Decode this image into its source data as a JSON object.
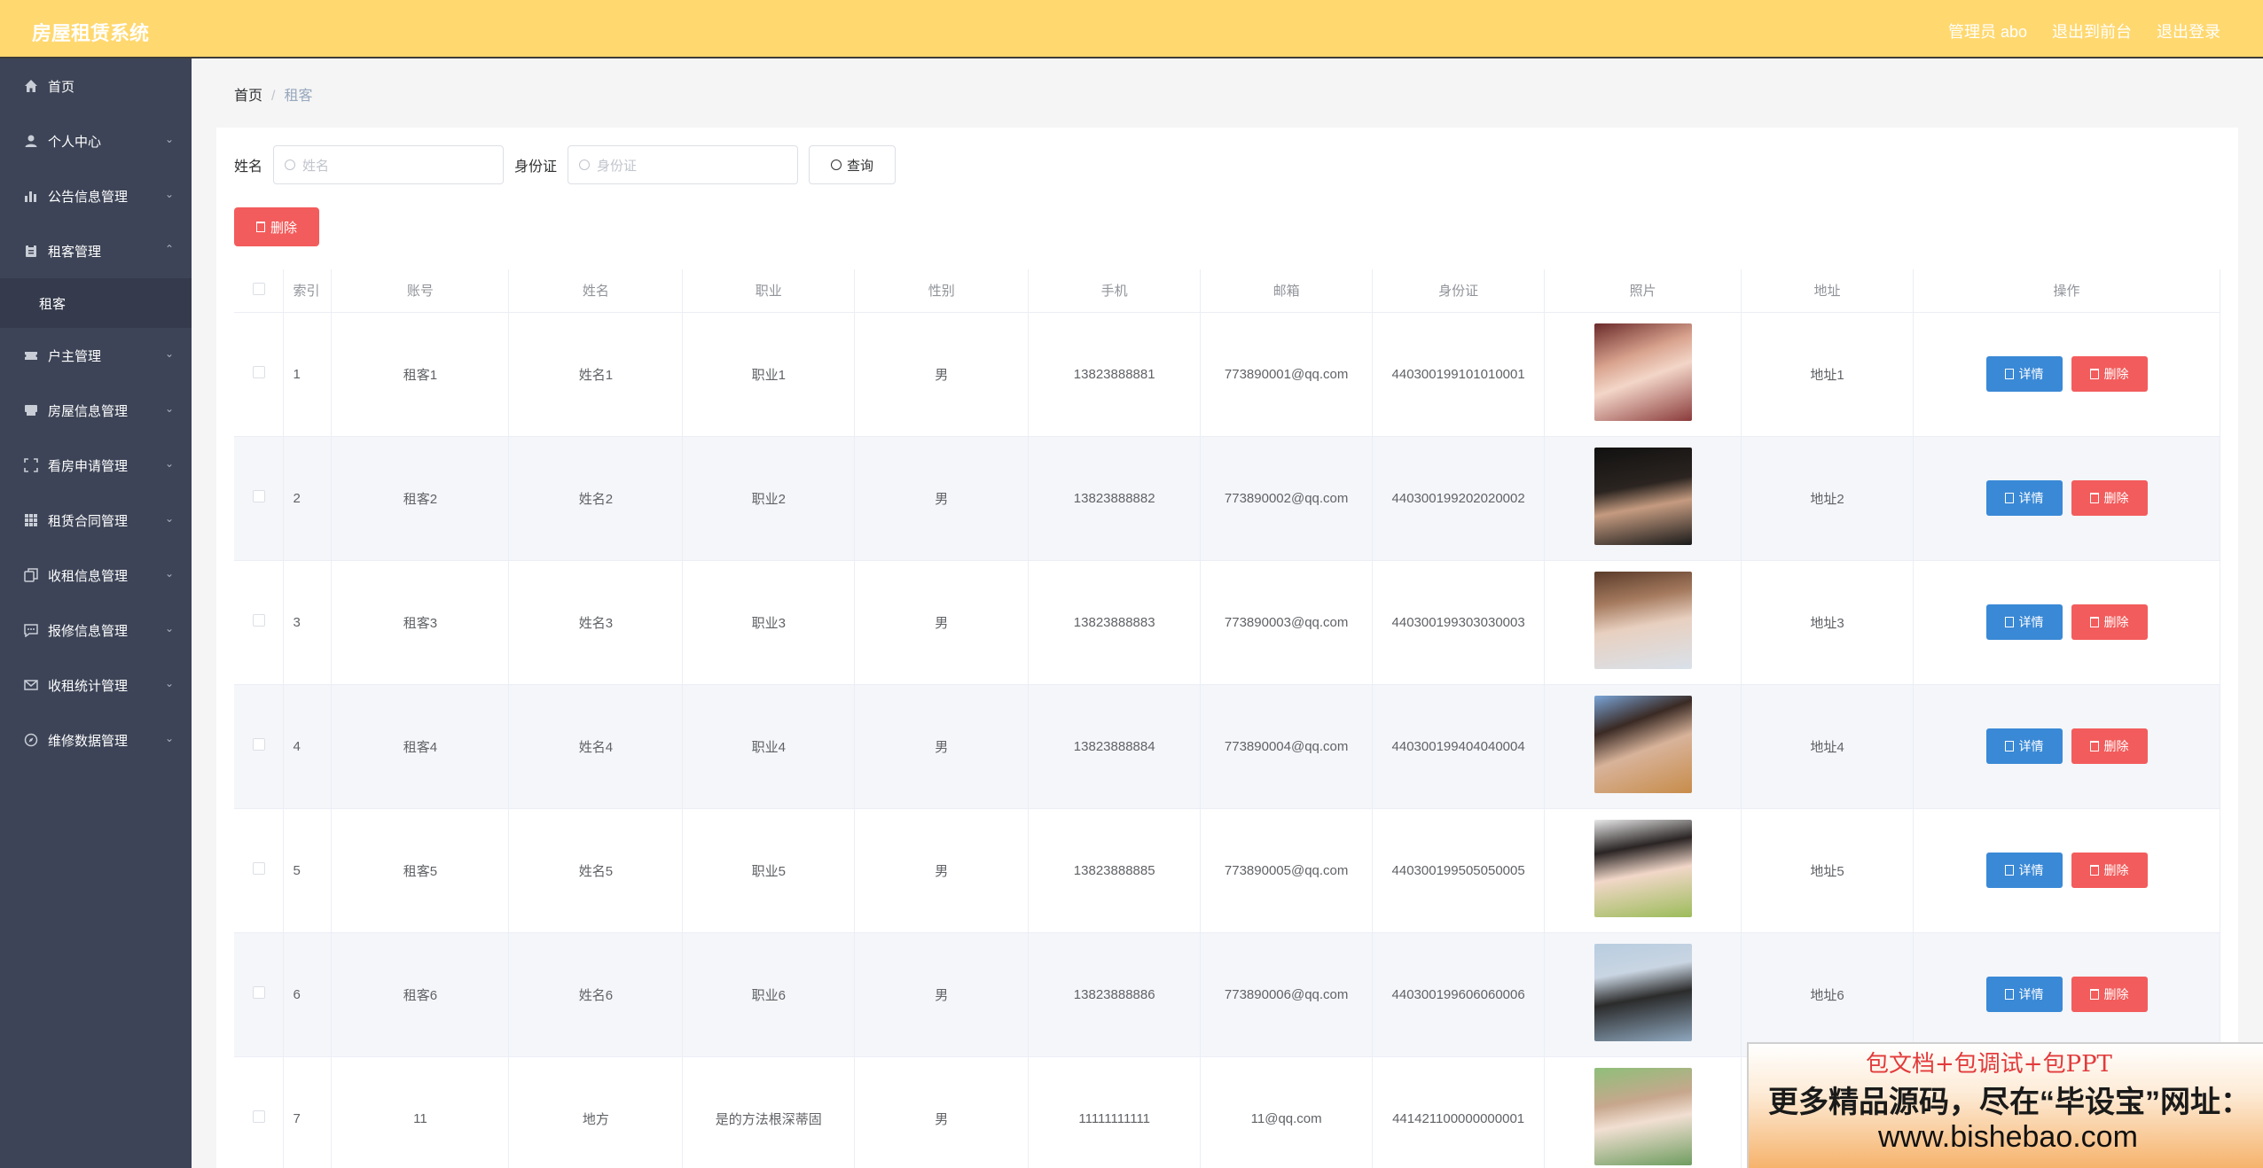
{
  "header": {
    "title": "房屋租赁系统",
    "admin": "管理员 abo",
    "back": "退出到前台",
    "logout": "退出登录"
  },
  "sidebar": {
    "items": [
      {
        "label": "首页",
        "icon": "home-icon"
      },
      {
        "label": "个人中心",
        "icon": "user-icon"
      },
      {
        "label": "公告信息管理",
        "icon": "chart-icon"
      },
      {
        "label": "租客管理",
        "icon": "clipboard-icon",
        "sub": "租客"
      },
      {
        "label": "户主管理",
        "icon": "ticket-icon"
      },
      {
        "label": "房屋信息管理",
        "icon": "archive-icon"
      },
      {
        "label": "看房申请管理",
        "icon": "fullscreen-icon"
      },
      {
        "label": "租赁合同管理",
        "icon": "grid-icon"
      },
      {
        "label": "收租信息管理",
        "icon": "copy-icon"
      },
      {
        "label": "报修信息管理",
        "icon": "chat-icon"
      },
      {
        "label": "收租统计管理",
        "icon": "message-icon"
      },
      {
        "label": "维修数据管理",
        "icon": "compass-icon"
      }
    ]
  },
  "breadcrumb": {
    "home": "首页",
    "current": "租客"
  },
  "search": {
    "name_label": "姓名",
    "name_placeholder": "姓名",
    "id_label": "身份证",
    "id_placeholder": "身份证",
    "query": "查询"
  },
  "toolbar": {
    "delete": "删除"
  },
  "table": {
    "headers": [
      "索引",
      "账号",
      "姓名",
      "职业",
      "性别",
      "手机",
      "邮箱",
      "身份证",
      "照片",
      "地址",
      "操作"
    ],
    "detail_label": "详情",
    "delete_label": "删除",
    "rows": [
      [
        "1",
        "租客1",
        "姓名1",
        "职业1",
        "男",
        "13823888881",
        "773890001@qq.com",
        "440300199101010001",
        "",
        "地址1"
      ],
      [
        "2",
        "租客2",
        "姓名2",
        "职业2",
        "男",
        "13823888882",
        "773890002@qq.com",
        "440300199202020002",
        "",
        "地址2"
      ],
      [
        "3",
        "租客3",
        "姓名3",
        "职业3",
        "男",
        "13823888883",
        "773890003@qq.com",
        "440300199303030003",
        "",
        "地址3"
      ],
      [
        "4",
        "租客4",
        "姓名4",
        "职业4",
        "男",
        "13823888884",
        "773890004@qq.com",
        "440300199404040004",
        "",
        "地址4"
      ],
      [
        "5",
        "租客5",
        "姓名5",
        "职业5",
        "男",
        "13823888885",
        "773890005@qq.com",
        "440300199505050005",
        "",
        "地址5"
      ],
      [
        "6",
        "租客6",
        "姓名6",
        "职业6",
        "男",
        "13823888886",
        "773890006@qq.com",
        "440300199606060006",
        "",
        "地址6"
      ],
      [
        "7",
        "11",
        "地方",
        "是的方法根深蒂固",
        "男",
        "11111111111",
        "11@qq.com",
        "441421100000000001",
        "",
        ""
      ]
    ]
  },
  "watermark": {
    "line1": "包文档+包调试+包PPT",
    "line2": "更多精品源码，尽在“毕设宝”网址：",
    "line3": "www.bishebao.com"
  },
  "colors": {
    "header_bg": "#ffd86f",
    "sidebar_bg": "#3d4457",
    "primary": "#3a89d6",
    "danger": "#f35c5c"
  }
}
